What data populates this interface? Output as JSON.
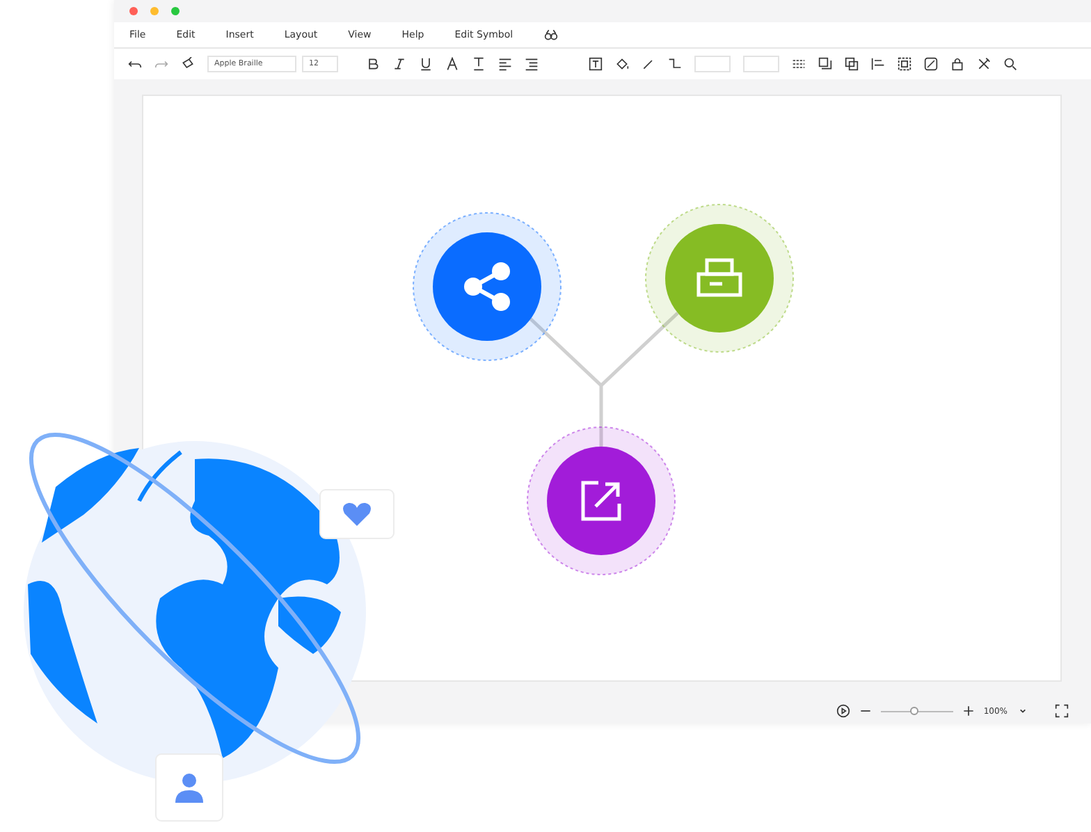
{
  "window": {
    "menu": [
      {
        "label": "File"
      },
      {
        "label": "Edit"
      },
      {
        "label": "Insert"
      },
      {
        "label": "Layout"
      },
      {
        "label": "View"
      },
      {
        "label": "Help"
      },
      {
        "label": "Edit Symbol"
      }
    ]
  },
  "toolbar": {
    "font": "Apple Braille",
    "font_size": "12"
  },
  "diagram": {
    "nodes": [
      {
        "kind": "share",
        "color": "#0a6cff"
      },
      {
        "kind": "printer",
        "color": "#86bc24"
      },
      {
        "kind": "export",
        "color": "#a21cd9"
      }
    ]
  },
  "status_bar": {
    "zoom": "100%",
    "zoom_slider": {
      "level": 0.47
    }
  }
}
